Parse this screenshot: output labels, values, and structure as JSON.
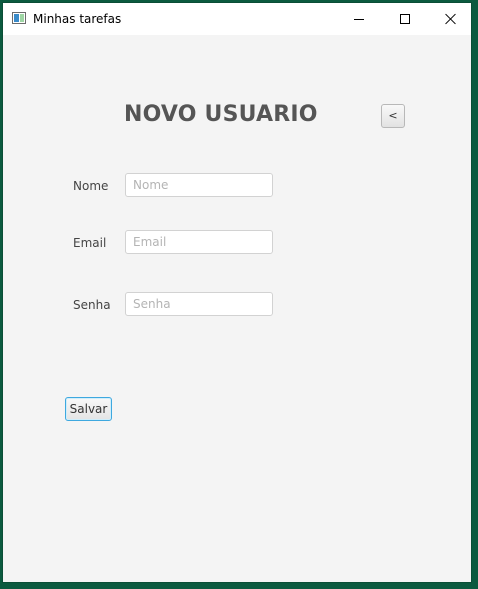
{
  "window": {
    "title": "Minhas tarefas",
    "icon": "app-window-icon",
    "controls": {
      "minimize_icon": "minimize-icon",
      "maximize_icon": "maximize-icon",
      "close_icon": "close-icon"
    }
  },
  "page": {
    "title": "NOVO USUARIO",
    "back_label": "<"
  },
  "form": {
    "fields": [
      {
        "label": "Nome",
        "value": "",
        "placeholder": "Nome",
        "type": "text"
      },
      {
        "label": "Email",
        "value": "",
        "placeholder": "Email",
        "type": "text"
      },
      {
        "label": "Senha",
        "value": "",
        "placeholder": "Senha",
        "type": "password"
      }
    ],
    "submit_label": "Salvar"
  },
  "colors": {
    "window_border": "#0b5a3f",
    "background": "#f4f4f4",
    "title_text": "#555555",
    "focus_accent": "#3ea8df"
  }
}
